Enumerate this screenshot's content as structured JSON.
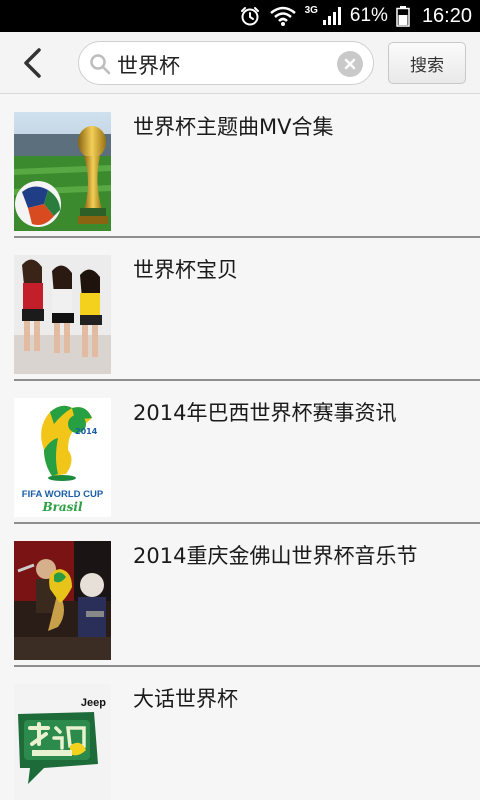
{
  "status_bar": {
    "icons": [
      "alarm-icon",
      "wifi-icon",
      "signal-icon",
      "battery-icon"
    ],
    "network_type": "3G",
    "battery": "61%",
    "time": "16:20"
  },
  "header": {
    "back_icon": "chevron-left-icon",
    "search_value": "世界杯",
    "search_button_label": "搜索",
    "clear_icon": "clear-icon"
  },
  "results": [
    {
      "title": "世界杯主题曲MV合集",
      "thumbnail": "trophy-and-ball-image"
    },
    {
      "title": "世界杯宝贝",
      "thumbnail": "models-photo-image"
    },
    {
      "title": "2014年巴西世界杯赛事资讯",
      "thumbnail": "fifa-logo-image",
      "thumbnail_text": "FIFA WORLD CUP",
      "thumbnail_subtext": "Brasil"
    },
    {
      "title": "2014重庆金佛山世界杯音乐节",
      "thumbnail": "concert-photo-image"
    },
    {
      "title": "大话世界杯",
      "thumbnail": "jeep-show-logo-image",
      "thumbnail_text": "Jeep"
    }
  ],
  "colors": {
    "status_bar_bg": "#000000",
    "header_bg": "#f4f4f4",
    "list_bg": "#f6f6f6",
    "divider": "#8e8e8e"
  }
}
